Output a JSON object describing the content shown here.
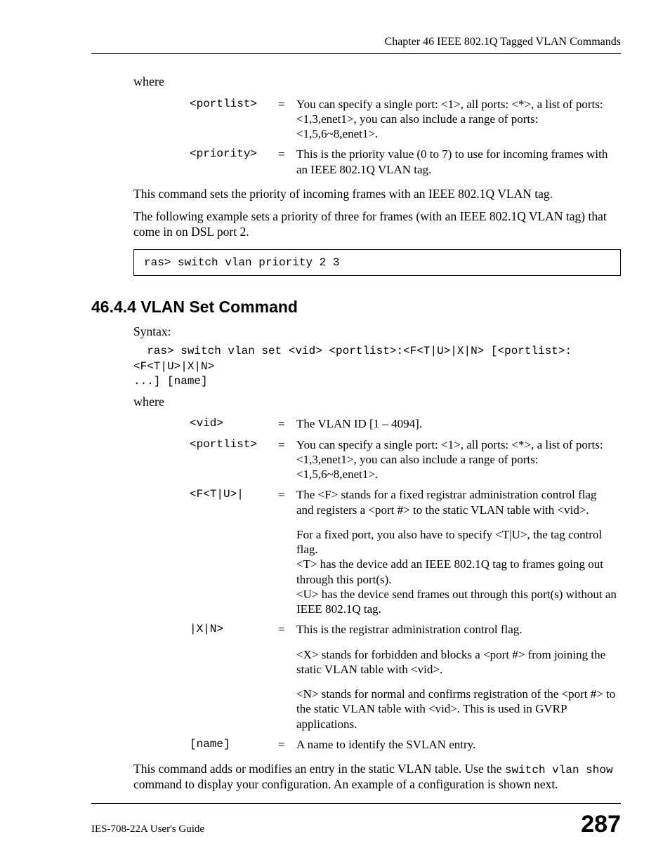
{
  "header": {
    "chapter": "Chapter 46 IEEE 802.1Q Tagged VLAN Commands"
  },
  "section1": {
    "where": "where",
    "params": [
      {
        "name": "<portlist>",
        "eq": "=",
        "desc": "You can specify a single port: <1>, all ports: <*>, a list of ports: <1,3,enet1>, you can also include a range of ports: <1,5,6~8,enet1>."
      },
      {
        "name": "<priority>",
        "eq": "=",
        "desc": "This is the priority value (0 to 7) to use for incoming frames with an IEEE 802.1Q VLAN tag."
      }
    ],
    "para1": "This command sets the priority of incoming frames with an IEEE 802.1Q VLAN tag.",
    "para2": "The following example sets a priority of three for frames (with an IEEE 802.1Q VLAN tag) that come in on DSL port 2.",
    "code": "ras> switch vlan priority 2 3"
  },
  "section2": {
    "heading": "46.4.4  VLAN Set Command",
    "syntax_label": "Syntax:",
    "syntax_code": "  ras> switch vlan set <vid> <portlist>:<F<T|U>|X|N> [<portlist>:<F<T|U>|X|N> \n...] [name]",
    "where": "where",
    "params": [
      {
        "name": "<vid>",
        "eq": "=",
        "desc": "The VLAN ID [1 – 4094]."
      },
      {
        "name": "<portlist>",
        "eq": "=",
        "desc": "You can specify a single port: <1>, all ports: <*>, a list of ports: <1,3,enet1>, you can also include a range of ports: <1,5,6~8,enet1>."
      },
      {
        "name": "<F<T|U>|",
        "eq": "=",
        "desc": "The <F> stands for a fixed registrar administration control flag and registers a <port #> to the static VLAN table with <vid>."
      },
      {
        "name": "",
        "eq": "",
        "desc": "For a fixed port, you also have to specify <T|U>, the tag control flag.\n<T> has the device add an IEEE 802.1Q tag to frames going out through this port(s).\n<U> has the device send frames out through this port(s) without an IEEE 802.1Q tag."
      },
      {
        "name": "|X|N>",
        "eq": "=",
        "desc": "This is the registrar administration control flag."
      },
      {
        "name": "",
        "eq": "",
        "desc": "<X> stands for forbidden and blocks a <port #> from joining the static VLAN table with <vid>."
      },
      {
        "name": "",
        "eq": "",
        "desc": "<N> stands for normal and confirms registration of the <port #> to the static VLAN table with <vid>. This is used in GVRP applications."
      },
      {
        "name": "[name]",
        "eq": "=",
        "desc": "A name to identify the SVLAN entry."
      }
    ],
    "closing_pre": "This command adds or modifies an entry in the static VLAN table. Use the ",
    "closing_code": "switch vlan show",
    "closing_post": " command to display your configuration. An example of a configuration is shown next."
  },
  "footer": {
    "guide": "IES-708-22A User's Guide",
    "page": "287"
  }
}
